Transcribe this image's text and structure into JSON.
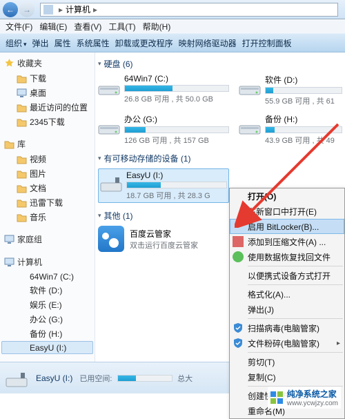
{
  "titlebar": {
    "location_label": "计算机"
  },
  "menubar": {
    "file": "文件(F)",
    "edit": "编辑(E)",
    "view": "查看(V)",
    "tools": "工具(T)",
    "help": "帮助(H)"
  },
  "toolbar": {
    "organize": "组织",
    "eject": "弹出",
    "properties": "属性",
    "system_properties": "系统属性",
    "uninstall": "卸载或更改程序",
    "map_drive": "映射网络驱动器",
    "control_panel": "打开控制面板"
  },
  "nav": {
    "favorites": "收藏夹",
    "fav_items": [
      "下载",
      "桌面",
      "最近访问的位置",
      "2345下载"
    ],
    "libraries": "库",
    "lib_items": [
      "视频",
      "图片",
      "文档",
      "迅雷下载",
      "音乐"
    ],
    "homegroup": "家庭组",
    "computer": "计算机",
    "drives": [
      "64Win7  (C:)",
      "软件  (D:)",
      "娱乐  (E:)",
      "办公  (G:)",
      "备份  (H:)",
      "EasyU  (I:)"
    ]
  },
  "content": {
    "hdd_header": "硬盘 (6)",
    "removable_header": "有可移动存储的设备 (1)",
    "other_header": "其他 (1)"
  },
  "drives": {
    "c": {
      "name": "64Win7 (C:)",
      "info": "26.8 GB 可用 , 共 50.0 GB",
      "fill": 46
    },
    "d": {
      "name": "软件 (D:)",
      "info": "55.9 GB 可用 , 共 61",
      "fill": 10
    },
    "g": {
      "name": "办公 (G:)",
      "info": "126 GB 可用 , 共 157 GB",
      "fill": 20
    },
    "h": {
      "name": "备份 (H:)",
      "info": "43.9 GB 可用 , 共 49",
      "fill": 12
    },
    "i": {
      "name": "EasyU (I:)",
      "info": "18.7 GB 可用 , 共 28.3 G",
      "fill": 34
    }
  },
  "other": {
    "name": "百度云管家",
    "sub": "双击运行百度云管家"
  },
  "context": {
    "open": "打开(O)",
    "open_new": "在新窗口中打开(E)",
    "bitlocker": "启用 BitLocker(B)...",
    "add_compress": "添加到压缩文件(A) ...",
    "restore": "使用数据恢复找回文件",
    "portable": "以便携式设备方式打开",
    "format": "格式化(A)...",
    "eject": "弹出(J)",
    "scan": "扫描病毒(电脑管家)",
    "shred": "文件粉碎(电脑管家)",
    "cut": "剪切(T)",
    "copy": "复制(C)",
    "shortcut": "创建快捷方式(S)",
    "rename": "重命名(M)"
  },
  "status": {
    "name": "EasyU (I:)",
    "used_label": "已用空间:",
    "total_label": "总大",
    "fill": 34
  },
  "watermark": {
    "title": "纯净系统之家",
    "url": "www.ycwjzy.com"
  }
}
